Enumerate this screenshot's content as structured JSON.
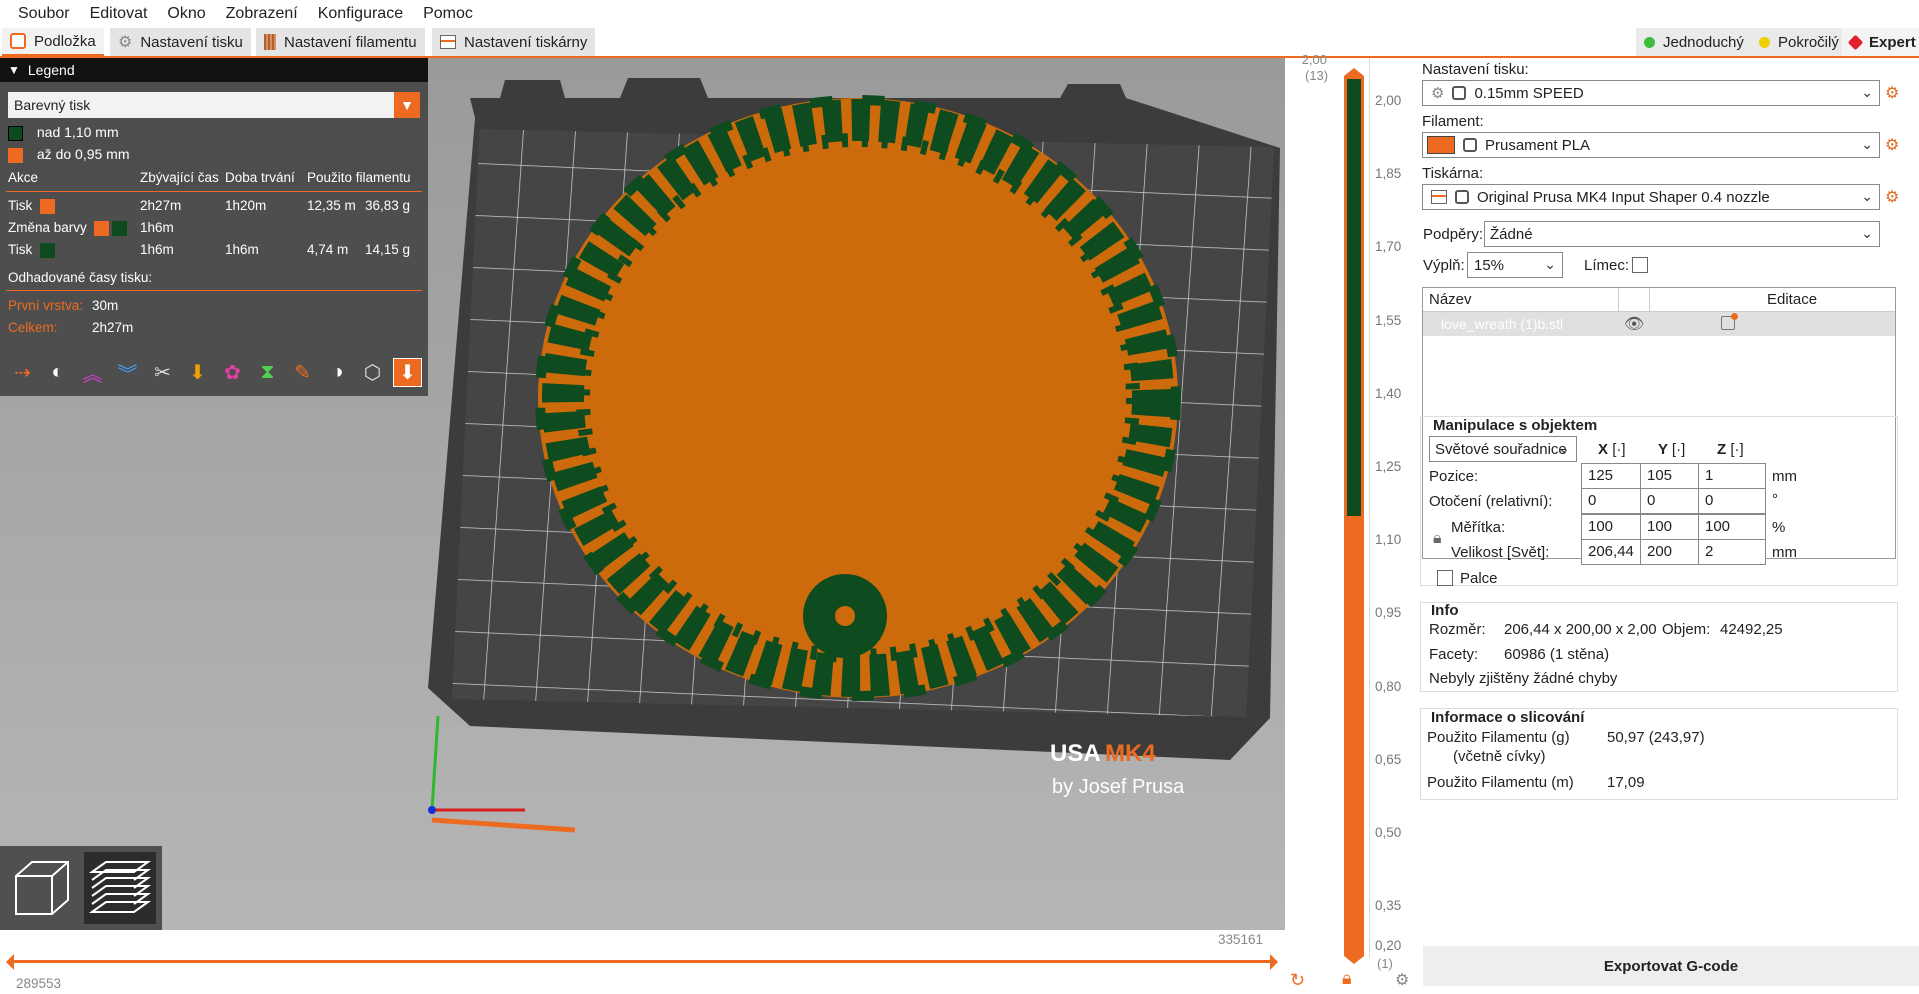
{
  "menu": [
    "Soubor",
    "Editovat",
    "Okno",
    "Zobrazení",
    "Konfigurace",
    "Pomoc"
  ],
  "tabs": [
    {
      "label": "Podložka",
      "icon": "bed-icon"
    },
    {
      "label": "Nastavení tisku",
      "icon": "gear-icon"
    },
    {
      "label": "Nastavení filamentu",
      "icon": "spool-icon"
    },
    {
      "label": "Nastavení tiskárny",
      "icon": "printer-icon"
    }
  ],
  "modes": [
    {
      "label": "Jednoduchý",
      "color": "#3ebd3e"
    },
    {
      "label": "Pokročilý",
      "color": "#f0d000"
    },
    {
      "label": "Expert",
      "color": "#e0202a"
    }
  ],
  "legend": {
    "title": "Legend",
    "view_type": "Barevný tisk",
    "ranges": [
      {
        "label": "nad 1,10 mm",
        "color": "#0d4a1e"
      },
      {
        "label": "až do 0,95 mm",
        "color": "#ed6b21"
      }
    ],
    "table_headers": [
      "Akce",
      "Zbývající čas",
      "Doba trvání",
      "Použito filamentu"
    ],
    "rows": [
      {
        "action": "Tisk",
        "remaining": "2h27m",
        "duration": "1h20m",
        "length": "12,35 m",
        "weight": "36,83 g"
      },
      {
        "action": "Změna barvy",
        "remaining": "1h6m",
        "duration": "",
        "length": "",
        "weight": ""
      },
      {
        "action": "Tisk",
        "remaining": "1h6m",
        "duration": "1h6m",
        "length": "4,74 m",
        "weight": "14,15 g"
      }
    ],
    "estimated_label": "Odhadované časy tisku:",
    "first_layer_label": "První vrstva:",
    "first_layer_value": "30m",
    "total_label": "Celkem:",
    "total_value": "2h27m"
  },
  "bed_logo": {
    "prefix": "USA",
    "model": "MK4",
    "byline": "by Josef Prusa"
  },
  "vertical_slider": {
    "top_value": "2,00",
    "top_layer": "(13)",
    "bottom_value": "0,20",
    "bottom_layer": "(1)",
    "ticks": [
      "2,00",
      "1,85",
      "1,70",
      "1,55",
      "1,40",
      "1,25",
      "1,10",
      "0,95",
      "0,80",
      "0,65",
      "0,50",
      "0,35",
      "0,20"
    ]
  },
  "horizontal_slider": {
    "right_value": "335161",
    "left_value": "289553"
  },
  "right_panel": {
    "print_settings_label": "Nastavení tisku:",
    "print_settings_value": "0.15mm SPEED",
    "filament_label": "Filament:",
    "filament_value": "Prusament PLA",
    "filament_color": "#ed6b21",
    "printer_label": "Tiskárna:",
    "printer_value": "Original Prusa MK4 Input Shaper 0.4 nozzle",
    "supports_label": "Podpěry:",
    "supports_value": "Žádné",
    "infill_label": "Výplň:",
    "infill_value": "15%",
    "brim_label": "Límec:",
    "objects_header_name": "Název",
    "objects_header_edit": "Editace",
    "object_name": "love_wreath (1)b.stl",
    "manip_title": "Manipulace s objektem",
    "coord_system": "Světové souřadnice",
    "axis_x": "X",
    "axis_y": "Y",
    "axis_z": "Z",
    "position_label": "Pozice:",
    "position": [
      "125",
      "105",
      "1"
    ],
    "position_unit": "mm",
    "rotation_label": "Otočení (relativní):",
    "rotation": [
      "0",
      "0",
      "0"
    ],
    "rotation_unit": "°",
    "scale_label": "Měřítka:",
    "scale": [
      "100",
      "100",
      "100"
    ],
    "scale_unit": "%",
    "size_label": "Velikost [Svět]:",
    "size": [
      "206,44",
      "200",
      "2"
    ],
    "size_unit": "mm",
    "inches_label": "Palce",
    "info_title": "Info",
    "size_info_label": "Rozměr:",
    "size_info_value": "206,44 x 200,00 x 2,00",
    "volume_label": "Objem:",
    "volume_value": "42492,25",
    "facets_label": "Facety:",
    "facets_value": "60986 (1 stěna)",
    "errors_text": "Nebyly zjištěny žádné chyby",
    "slice_title": "Informace o slicování",
    "filament_g_label": "Použito Filamentu (g)",
    "filament_g_sub": "(včetně cívky)",
    "filament_g_value": "50,97 (243,97)",
    "filament_m_label": "Použito Filamentu (m)",
    "filament_m_value": "17,09",
    "export_label": "Exportovat G-code"
  }
}
